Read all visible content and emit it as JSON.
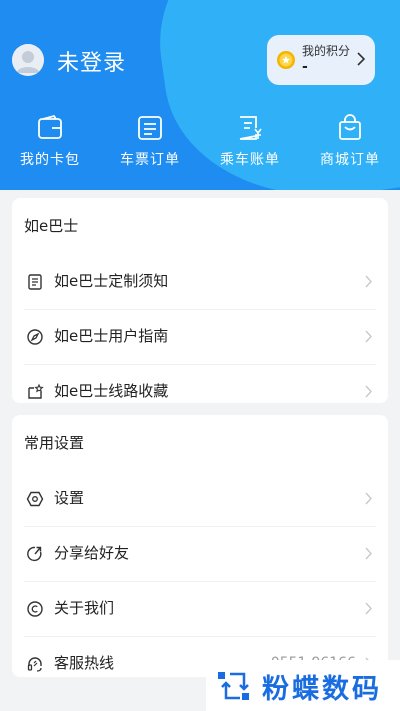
{
  "user": {
    "name": "未登录"
  },
  "points": {
    "label": "我的积分",
    "value": "-"
  },
  "quick_nav": [
    {
      "label": "我的卡包",
      "icon": "wallet-icon"
    },
    {
      "label": "车票订单",
      "icon": "ticket-order-icon"
    },
    {
      "label": "乘车账单",
      "icon": "bill-icon"
    },
    {
      "label": "商城订单",
      "icon": "shopping-bag-icon"
    }
  ],
  "section_bus": {
    "title": "如e巴士",
    "items": [
      {
        "label": "如e巴士定制须知",
        "icon": "notice-icon"
      },
      {
        "label": "如e巴士用户指南",
        "icon": "compass-icon"
      },
      {
        "label": "如e巴士线路收藏",
        "icon": "favorite-icon"
      }
    ]
  },
  "section_settings": {
    "title": "常用设置",
    "items": [
      {
        "label": "设置",
        "icon": "settings-icon"
      },
      {
        "label": "分享给好友",
        "icon": "share-icon"
      },
      {
        "label": "关于我们",
        "icon": "copyright-icon"
      },
      {
        "label": "客服热线",
        "icon": "headset-icon",
        "value": "0551-96166"
      }
    ]
  },
  "watermark": {
    "text": "粉蝶数码"
  },
  "colors": {
    "header_blue": "#1e8cf0",
    "header_light": "#2fb0f7",
    "watermark_blue": "#1a6de0"
  }
}
